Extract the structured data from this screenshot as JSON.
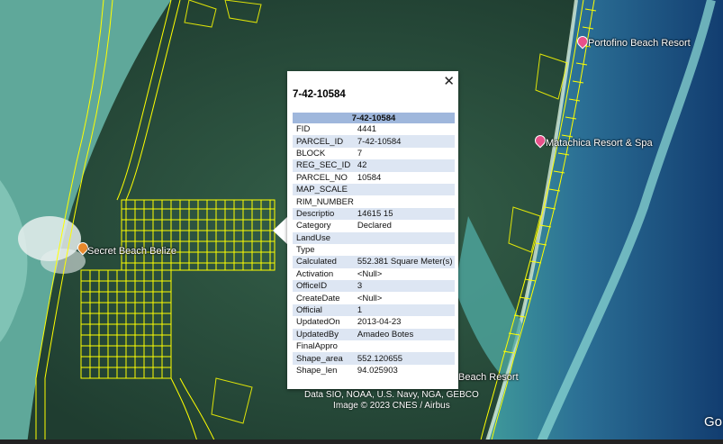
{
  "map": {
    "places": [
      {
        "name": "Portofino Beach Resort",
        "pin": "pink"
      },
      {
        "name": "Matachica Resort & Spa",
        "pin": "pink"
      },
      {
        "name": "Secret Beach Belize",
        "pin": "orange"
      },
      {
        "name": "Beach Resort",
        "pin": "none"
      }
    ],
    "credit_line1": "Data SIO, NOAA, U.S. Navy, NGA, GEBCO",
    "credit_line2": "Image © 2023 CNES / Airbus",
    "brand": "Go"
  },
  "popup": {
    "title": "7-42-10584",
    "table_header": "7-42-10584",
    "close_icon": "close-icon",
    "rows": [
      {
        "key": "FID",
        "value": "4441"
      },
      {
        "key": "PARCEL_ID",
        "value": "7-42-10584"
      },
      {
        "key": "BLOCK",
        "value": "7"
      },
      {
        "key": "REG_SEC_ID",
        "value": "42"
      },
      {
        "key": "PARCEL_NO",
        "value": "10584"
      },
      {
        "key": "MAP_SCALE",
        "value": ""
      },
      {
        "key": "RIM_NUMBER",
        "value": ""
      },
      {
        "key": "Descriptio",
        "value": "14615 15"
      },
      {
        "key": "Category",
        "value": "Declared"
      },
      {
        "key": "LandUse",
        "value": ""
      },
      {
        "key": "Type",
        "value": ""
      },
      {
        "key": "Calculated",
        "value": "552.381 Square Meter(s)"
      },
      {
        "key": "Activation",
        "value": "<Null>"
      },
      {
        "key": "OfficeID",
        "value": "3"
      },
      {
        "key": "CreateDate",
        "value": "<Null>"
      },
      {
        "key": "Official",
        "value": "1"
      },
      {
        "key": "UpdatedOn",
        "value": "2013-04-23"
      },
      {
        "key": "UpdatedBy",
        "value": "Amadeo Botes"
      },
      {
        "key": "FinalAppro",
        "value": ""
      },
      {
        "key": "Shape_area",
        "value": "552.120655"
      },
      {
        "key": "Shape_len",
        "value": "94.025903"
      }
    ]
  },
  "colors": {
    "parcel_lines": "#ffff00",
    "table_header_bg": "#9fb7dc",
    "table_alt_row_bg": "#dde6f3",
    "ocean_deep": "#1e5a8a",
    "reef": "#6cc3c7"
  }
}
